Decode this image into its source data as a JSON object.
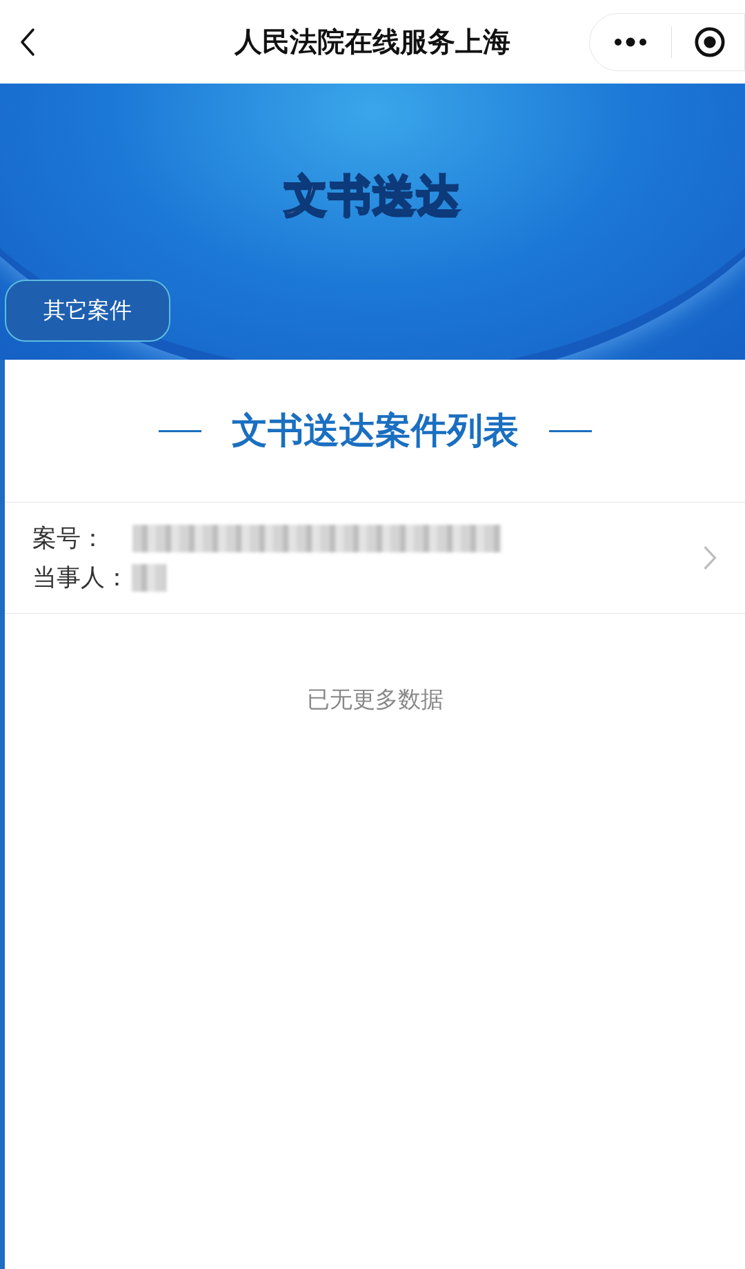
{
  "nav_bar": {
    "title": "人民法院在线服务上海"
  },
  "banner": {
    "title": "文书送达",
    "button": "其它案件"
  },
  "list": {
    "heading": "文书送达案件列表",
    "items": [
      {
        "fields": [
          {
            "label": "案号："
          },
          {
            "label": "当事人："
          }
        ]
      }
    ],
    "end_text": "已无更多数据"
  }
}
